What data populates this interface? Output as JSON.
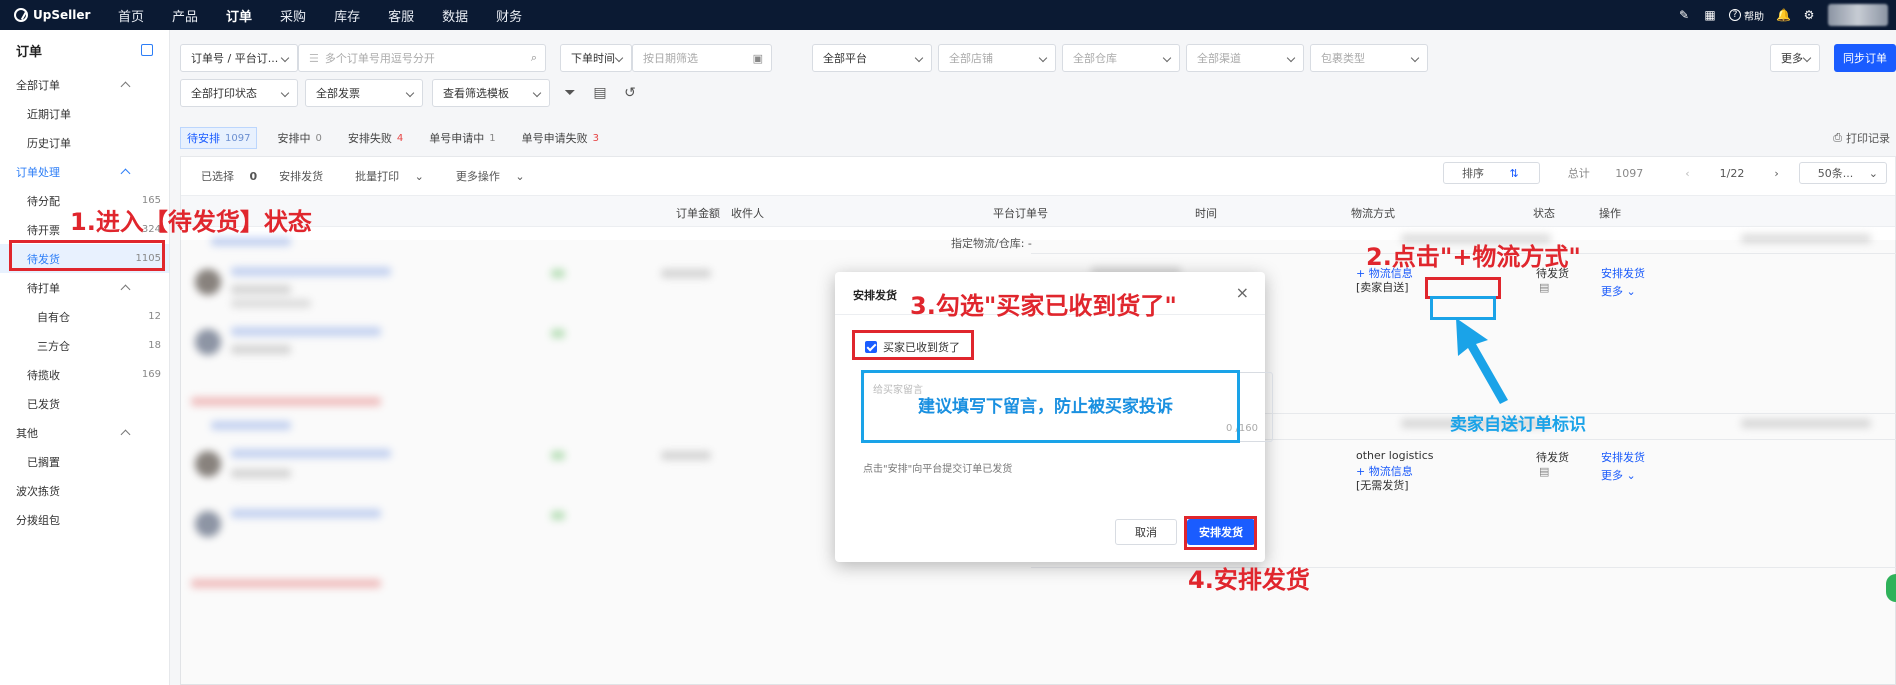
{
  "topnav": {
    "brand": "UpSeller",
    "items": [
      "首页",
      "产品",
      "订单",
      "采购",
      "库存",
      "客服",
      "数据",
      "财务"
    ],
    "help": "帮助"
  },
  "sidebar": {
    "title": "订单",
    "items": [
      {
        "label": "全部订单",
        "count": ""
      },
      {
        "label": "近期订单",
        "count": ""
      },
      {
        "label": "历史订单",
        "count": ""
      },
      {
        "label": "订单处理",
        "count": ""
      },
      {
        "label": "待分配",
        "count": "165"
      },
      {
        "label": "待开票",
        "count": "324"
      },
      {
        "label": "待发货",
        "count": "1105"
      },
      {
        "label": "待打单",
        "count": ""
      },
      {
        "label": "自有仓",
        "count": "12"
      },
      {
        "label": "三方仓",
        "count": "18"
      },
      {
        "label": "待揽收",
        "count": "169"
      },
      {
        "label": "已发货",
        "count": ""
      },
      {
        "label": "其他",
        "count": ""
      },
      {
        "label": "已搁置",
        "count": ""
      },
      {
        "label": "波次拣货",
        "count": ""
      },
      {
        "label": "分拨组包",
        "count": ""
      }
    ]
  },
  "filters": {
    "order_no_select": "订单号 / 平台订...",
    "search_placeholder": "多个订单号用逗号分开",
    "time_select": "下单时间",
    "date_placeholder": "按日期筛选",
    "platform": "全部平台",
    "shop": "全部店铺",
    "warehouse": "全部仓库",
    "channel": "全部渠道",
    "package": "包裹类型",
    "more": "更多",
    "sync": "同步订单",
    "print_status": "全部打印状态",
    "invoice": "全部发票",
    "template": "查看筛选模板"
  },
  "tabs": [
    {
      "label": "待安排",
      "count": "1097"
    },
    {
      "label": "安排中",
      "count": "0"
    },
    {
      "label": "安排失败",
      "count": "4"
    },
    {
      "label": "单号申请中",
      "count": "1"
    },
    {
      "label": "单号申请失败",
      "count": "3"
    }
  ],
  "print_record": "打印记录",
  "toolbar": {
    "selected_label": "已选择",
    "selected_count": "0",
    "arrange": "安排发货",
    "batch_print": "批量打印",
    "more_ops": "更多操作",
    "sort": "排序",
    "total_label": "总计",
    "total": "1097",
    "page": "1/22",
    "page_size": "50条..."
  },
  "columns": [
    "订单金额",
    "收件人",
    "平台订单号",
    "时间",
    "物流方式",
    "状态",
    "操作"
  ],
  "rows": {
    "assigned_warehouse": "指定物流/仓库: -",
    "row1": {
      "logistics_link": "+ 物流信息",
      "tag": "[卖家自送]",
      "status": "待发货",
      "action": "安排发货",
      "more": "更多"
    },
    "row2": {
      "logistics_name": "other logistics",
      "logistics_link": "+ 物流信息",
      "tag": "[无需发货]",
      "status": "待发货",
      "action": "安排发货",
      "more": "更多"
    }
  },
  "modal": {
    "title": "安排发货",
    "checkbox": "买家已收到货了",
    "textarea_placeholder": "给买家留言",
    "counter": "0 /160",
    "hint": "点击\"安排\"向平台提交订单已发货",
    "cancel": "取消",
    "confirm": "安排发货"
  },
  "annotations": {
    "step1": "1.进入【待发货】状态",
    "step2": "2.点击\"+物流方式\"",
    "step3": "3.勾选\"买家已收到货了\"",
    "step4": "4.安排发货",
    "note_message": "建议填写下留言，防止被买家投诉",
    "note_tag": "卖家自送订单标识"
  }
}
